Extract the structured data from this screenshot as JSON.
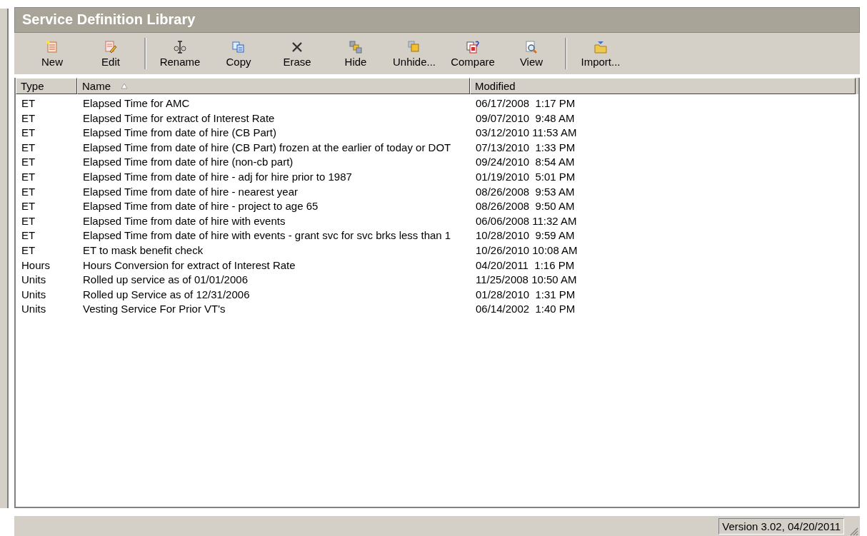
{
  "window": {
    "title": "Service Definition Library"
  },
  "toolbar": [
    {
      "kind": "button",
      "label": "New"
    },
    {
      "kind": "button",
      "label": "Edit"
    },
    {
      "kind": "separator"
    },
    {
      "kind": "button",
      "label": "Rename"
    },
    {
      "kind": "button",
      "label": "Copy"
    },
    {
      "kind": "button",
      "label": "Erase"
    },
    {
      "kind": "button",
      "label": "Hide"
    },
    {
      "kind": "button",
      "label": "Unhide..."
    },
    {
      "kind": "button",
      "label": "Compare"
    },
    {
      "kind": "button",
      "label": "View"
    },
    {
      "kind": "separator"
    },
    {
      "kind": "button",
      "label": "Import..."
    }
  ],
  "table": {
    "columns": [
      {
        "label": "Type"
      },
      {
        "label": "Name",
        "sorted": true
      },
      {
        "label": "Modified"
      }
    ],
    "rows": [
      [
        "ET",
        "Elapsed Time for AMC",
        "06/17/2008  1:17 PM"
      ],
      [
        "ET",
        "Elapsed Time for extract of Interest Rate",
        "09/07/2010  9:48 AM"
      ],
      [
        "ET",
        "Elapsed Time from date of hire (CB Part)",
        "03/12/2010 11:53 AM"
      ],
      [
        "ET",
        "Elapsed Time from date of hire (CB Part) frozen at the earlier of today or DOT",
        "07/13/2010  1:33 PM"
      ],
      [
        "ET",
        "Elapsed Time from date of hire (non-cb part)",
        "09/24/2010  8:54 AM"
      ],
      [
        "ET",
        "Elapsed Time from date of hire - adj for hire prior to 1987",
        "01/19/2010  5:01 PM"
      ],
      [
        "ET",
        "Elapsed Time from date of hire - nearest year",
        "08/26/2008  9:53 AM"
      ],
      [
        "ET",
        "Elapsed Time from date of hire - project to age 65",
        "08/26/2008  9:50 AM"
      ],
      [
        "ET",
        "Elapsed Time from date of hire with events",
        "06/06/2008 11:32 AM"
      ],
      [
        "ET",
        "Elapsed Time from date of hire with events - grant svc for svc brks less than 1",
        "10/28/2010  9:59 AM"
      ],
      [
        "ET",
        "ET to mask benefit check",
        "10/26/2010 10:08 AM"
      ],
      [
        "Hours",
        "Hours Conversion for extract of Interest Rate",
        "04/20/2011  1:16 PM"
      ],
      [
        "Units",
        "Rolled up service as of 01/01/2006",
        "11/25/2008 10:50 AM"
      ],
      [
        "Units",
        "Rolled up Service as of 12/31/2006",
        "01/28/2010  1:31 PM"
      ],
      [
        "Units",
        "Vesting Service For Prior VT's",
        "06/14/2002  1:40 PM"
      ]
    ]
  },
  "status_bar": {
    "version": "Version 3.02, 04/20/2011"
  }
}
